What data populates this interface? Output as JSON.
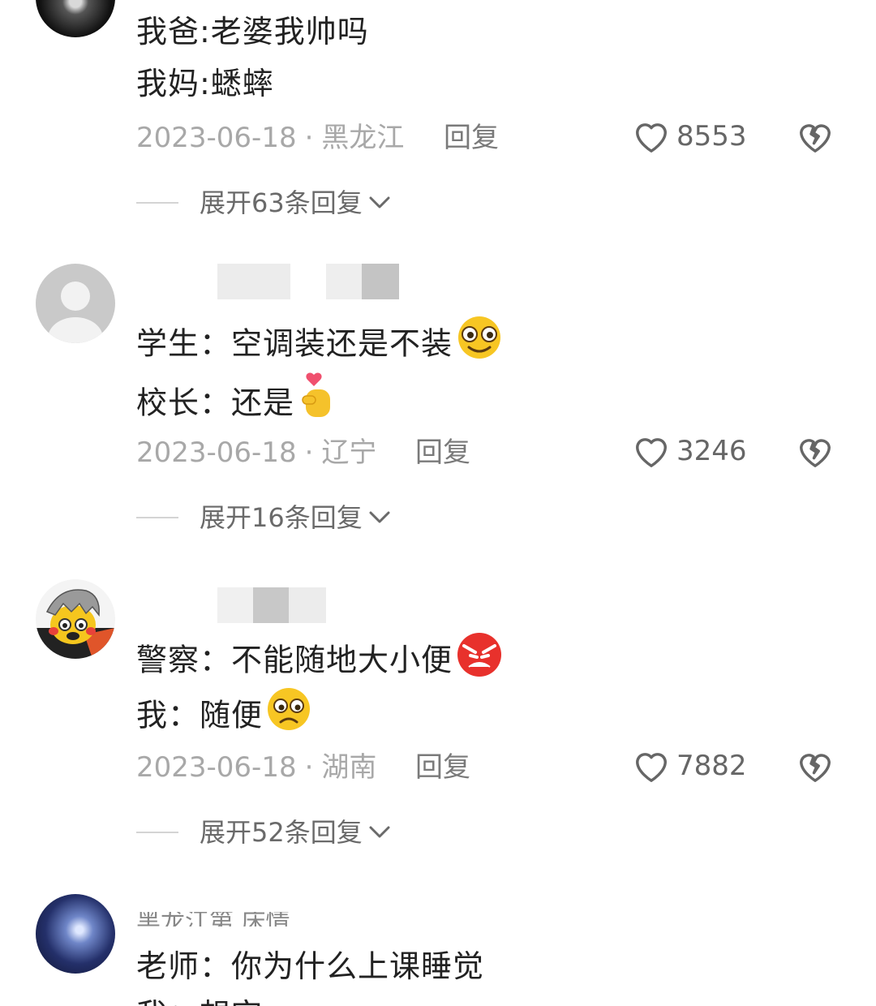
{
  "comments": [
    {
      "lines": [
        "我爸:老婆我帅吗",
        "我妈:蟋蟀"
      ],
      "date": "2023-06-18",
      "location": "黑龙江",
      "reply_label": "回复",
      "likes": "8553",
      "expand_label": "展开63条回复"
    },
    {
      "lines": [
        "学生：空调装还是不装",
        "校长：还是"
      ],
      "date": "2023-06-18",
      "location": "辽宁",
      "reply_label": "回复",
      "likes": "3246",
      "expand_label": "展开16条回复"
    },
    {
      "lines": [
        "警察：不能随地大小便",
        "我：随便"
      ],
      "date": "2023-06-18",
      "location": "湖南",
      "reply_label": "回复",
      "likes": "7882",
      "expand_label": "展开52条回复"
    },
    {
      "username_partial": "黑龙江第   床情",
      "lines": [
        "老师：你为什么上课睡觉",
        "我：想空"
      ]
    }
  ],
  "icons": {
    "like": "heart-outline-icon",
    "dislike": "broken-heart-icon",
    "expand": "chevron-down-icon"
  },
  "colors": {
    "text": "#222222",
    "meta": "#a8a8a8",
    "action": "#7a7a7a"
  }
}
